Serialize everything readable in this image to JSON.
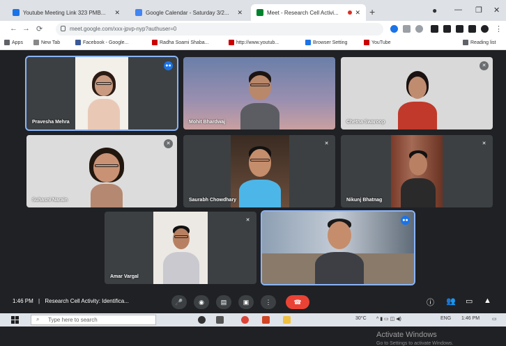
{
  "browser": {
    "tabs": [
      {
        "title": "Youtube Meeting Link 323 PMB...",
        "fav_color": "#1a73e8"
      },
      {
        "title": "Google Calendar - Saturday 3/2...",
        "fav_color": "#4285f4"
      },
      {
        "title": "Meet - Research Cell Activi...",
        "fav_color": "#00832d"
      }
    ],
    "newtab_label": "+",
    "address": "meet.google.com/xxx-jpvp-nyp?authuser=0",
    "bookmarks": [
      {
        "label": "Apps",
        "color": "#5f6368"
      },
      {
        "label": "New Tab",
        "color": "#888"
      },
      {
        "label": "Facebook - Google...",
        "color": "#3b5998"
      },
      {
        "label": "Radha Soami Shaba...",
        "color": "#c00"
      },
      {
        "label": "http://www.youtub...",
        "color": "#c00"
      },
      {
        "label": "Browser Setting",
        "color": "#1a73e8"
      },
      {
        "label": "YouTube",
        "color": "#c00"
      },
      {
        "label": "Reading list",
        "color": "#5f6368"
      }
    ]
  },
  "participants": [
    {
      "name": "Pravesha Mehra",
      "status": "speaking"
    },
    {
      "name": "Mohit Bhardwaj",
      "status": "none"
    },
    {
      "name": "Chetna Swaroop",
      "status": "muted"
    },
    {
      "name": "Suhasni Narain",
      "status": "muted"
    },
    {
      "name": "Saurabh Chowdhary",
      "status": "muted"
    },
    {
      "name": "Nikunj Bhatnag",
      "status": "muted"
    },
    {
      "name": "Amar Vargal",
      "status": "muted"
    },
    {
      "name": "",
      "status": "speaking"
    }
  ],
  "meeting": {
    "time": "1:46 PM",
    "separator": "|",
    "title": "Research Cell Activity: Identifica..."
  },
  "watermark": {
    "line1": "Activate Windows",
    "line2": "Go to Settings to activate Windows."
  },
  "taskbar": {
    "search_placeholder": "Type here to search",
    "tray_temp": "30°C",
    "tray_lang": "ENG",
    "tray_time": "1:46 PM"
  }
}
